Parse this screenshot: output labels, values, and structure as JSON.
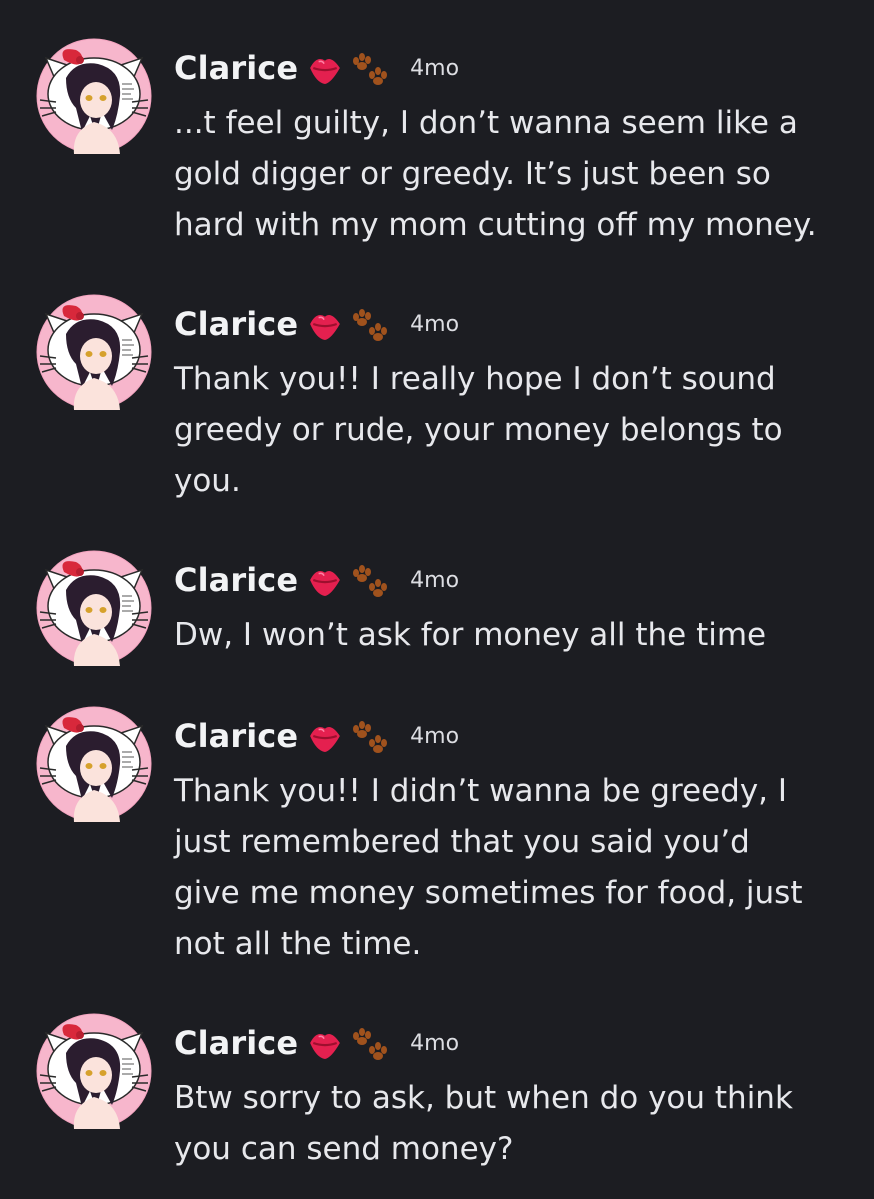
{
  "messages": [
    {
      "author": "Clarice",
      "badges": [
        "kiss-mark-emoji",
        "paw-prints-emoji"
      ],
      "time": "4mo",
      "text": "...t feel guilty, I don’t wanna seem like a\ngold digger or greedy.  It’s just been so\nhard with my mom cutting off my money."
    },
    {
      "author": "Clarice",
      "badges": [
        "kiss-mark-emoji",
        "paw-prints-emoji"
      ],
      "time": "4mo",
      "text": "Thank you!!  I really hope I don’t sound\ngreedy or rude, your money belongs to\nyou."
    },
    {
      "author": "Clarice",
      "badges": [
        "kiss-mark-emoji",
        "paw-prints-emoji"
      ],
      "time": "4mo",
      "text": "Dw, I won’t ask for money all the time"
    },
    {
      "author": "Clarice",
      "badges": [
        "kiss-mark-emoji",
        "paw-prints-emoji"
      ],
      "time": "4mo",
      "text": "Thank you!!  I didn’t wanna be greedy, I\njust remembered that you said you’d\ngive me money sometimes for food, just\nnot all the time."
    },
    {
      "author": "Clarice",
      "badges": [
        "kiss-mark-emoji",
        "paw-prints-emoji"
      ],
      "time": "4mo",
      "text": "Btw sorry to ask, but when do you think\nyou can send money?"
    }
  ],
  "colors": {
    "background": "#1c1d22",
    "username": "#f2f3f5",
    "message_text": "#e7e8ec",
    "timestamp": "#dcdde2",
    "avatar_pink": "#f7b6cc",
    "kiss_red": "#e4204f",
    "paw_brown": "#a0521d"
  }
}
